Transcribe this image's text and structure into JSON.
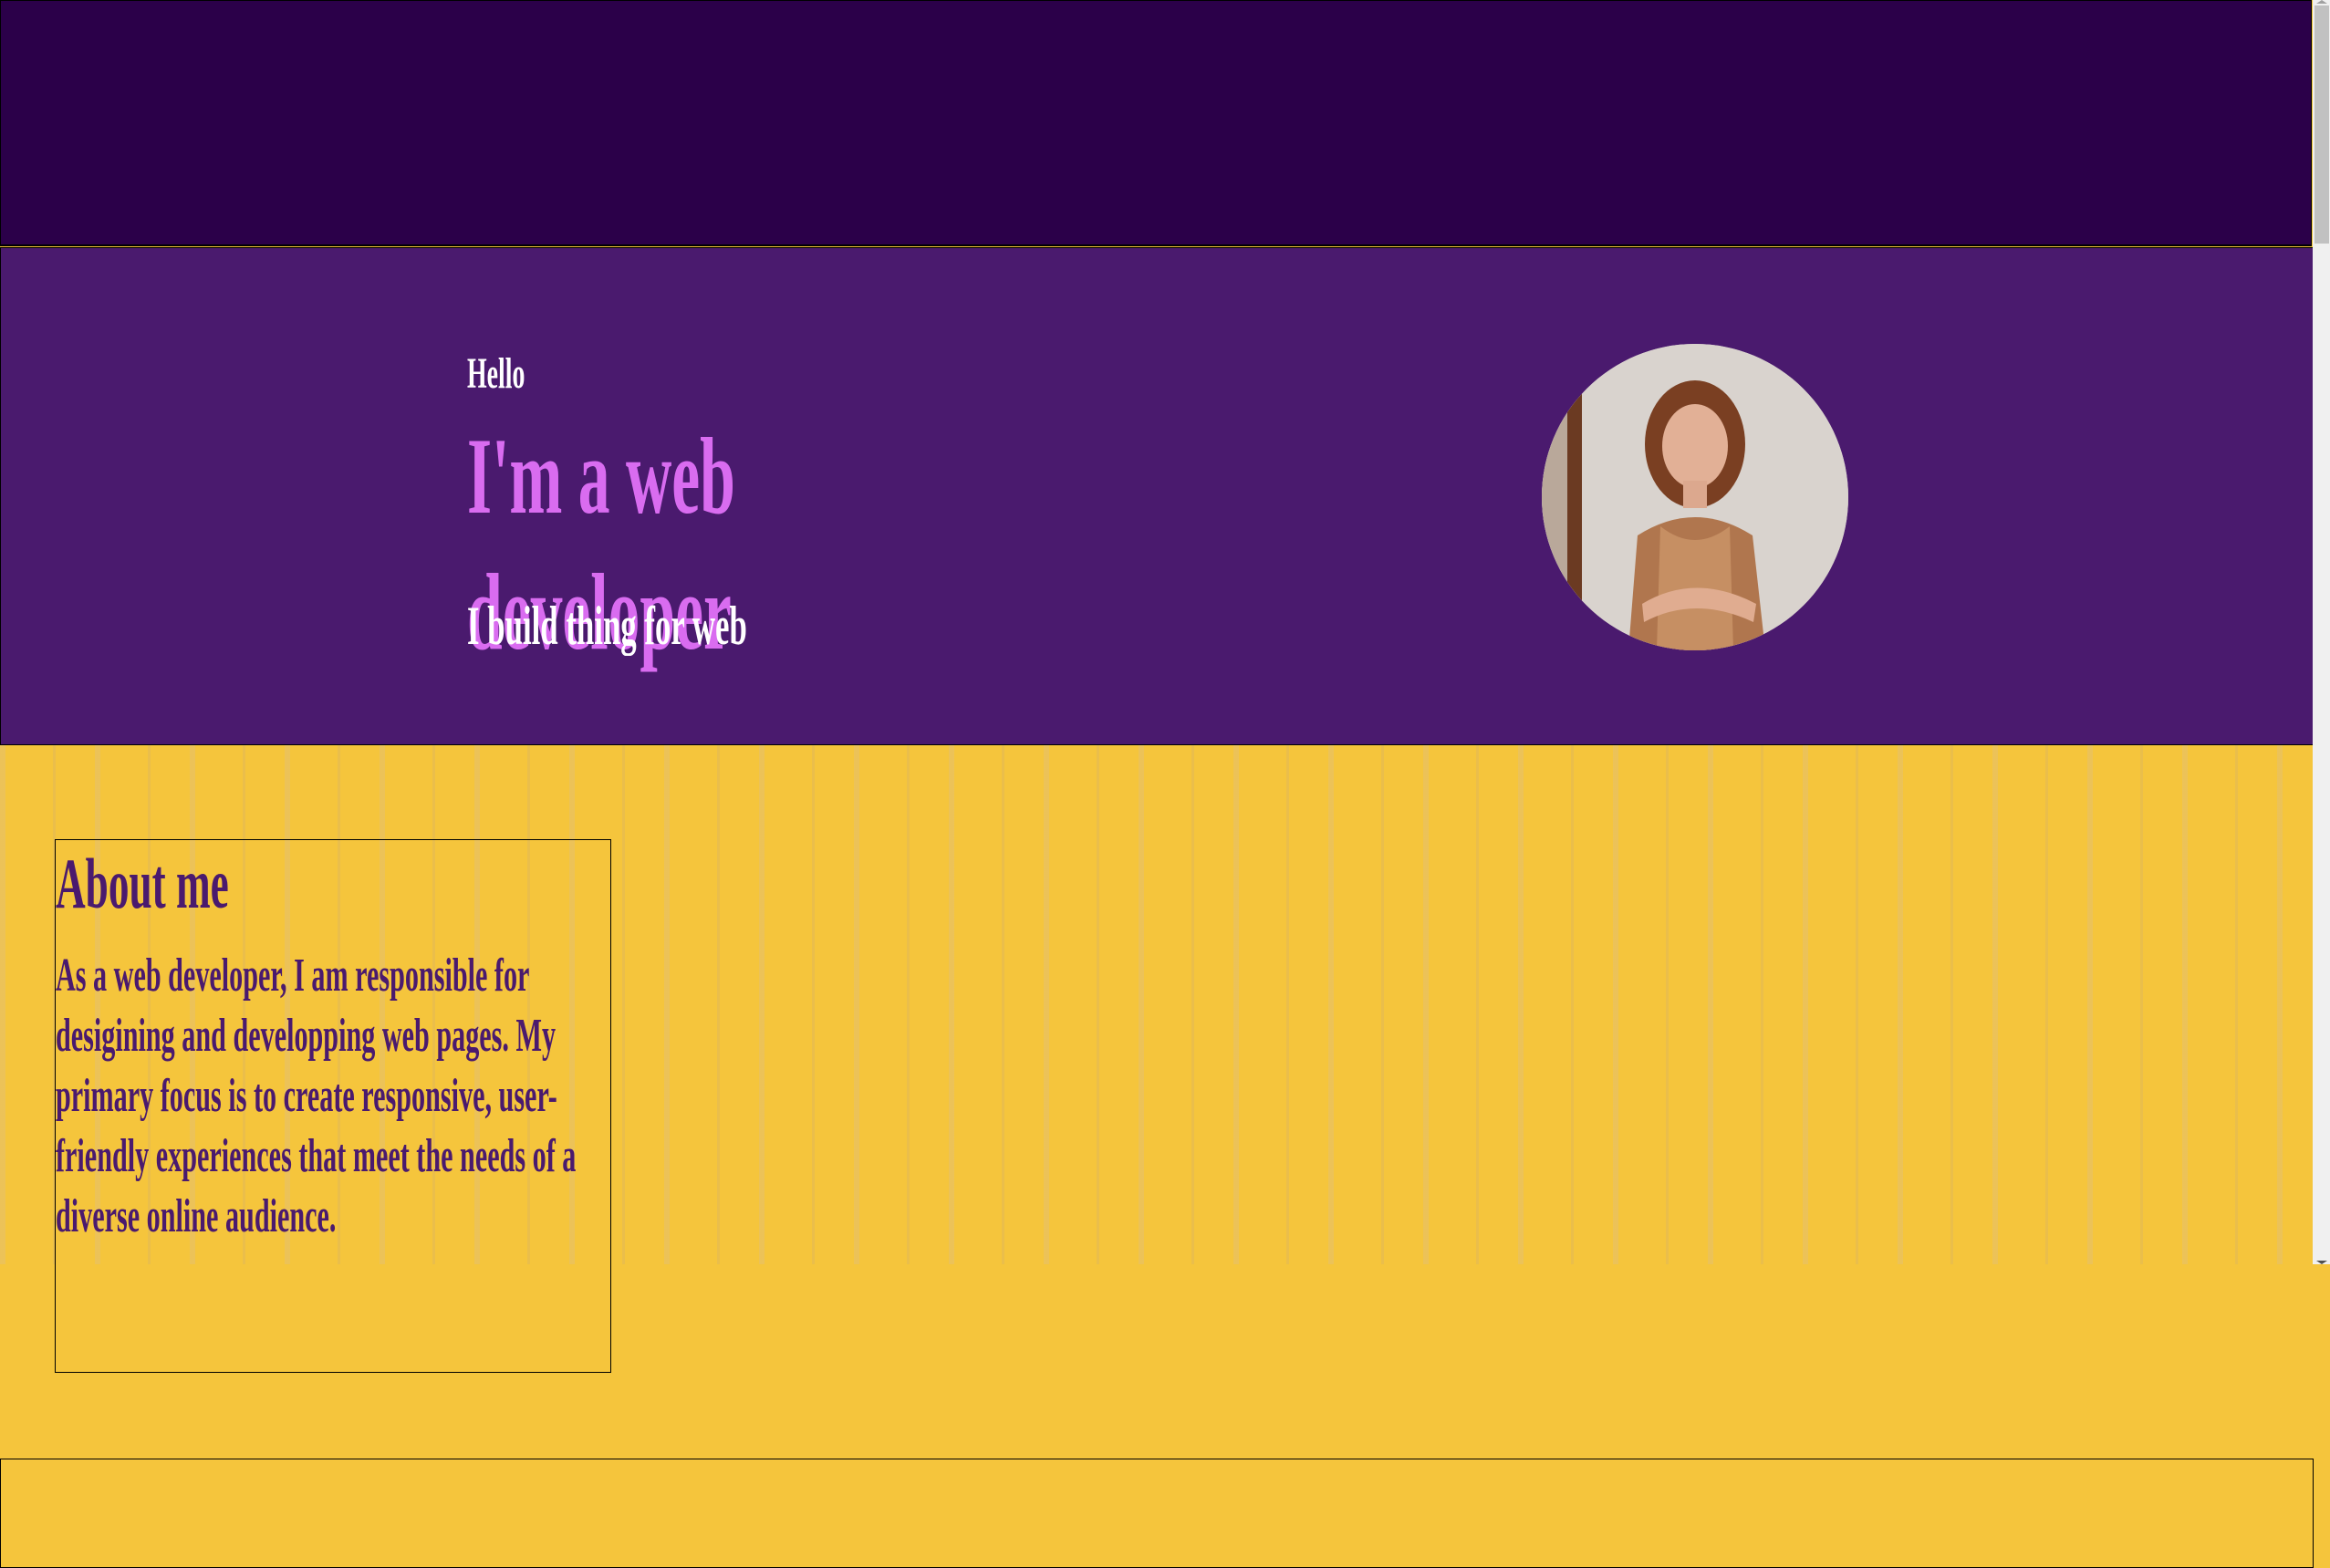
{
  "hero": {
    "greeting": "Hello",
    "title": "I'm a web developer",
    "subtitle": "I build thing for web"
  },
  "about": {
    "heading": "About me",
    "text": "As a web developer, I am responsible for desigining and developping web pages. My primary focus is to create responsive, user-friendly experiences that meet the needs of a diverse online audience."
  },
  "colors": {
    "header_bg": "#2b0049",
    "hero_bg": "#4a1a6e",
    "accent": "#d96cf0",
    "section_bg": "#f5c53c"
  }
}
